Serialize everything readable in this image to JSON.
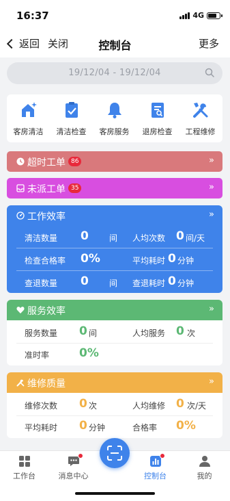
{
  "status_bar": {
    "time": "16:37",
    "network": "4G"
  },
  "nav": {
    "back_label": "返回",
    "close_label": "关闭",
    "title": "控制台",
    "more_label": "更多"
  },
  "date_range": "19/12/04 - 19/12/04",
  "quick_actions": [
    {
      "label": "客房清洁",
      "icon": "house-sparkle-icon"
    },
    {
      "label": "清洁检查",
      "icon": "clipboard-check-icon"
    },
    {
      "label": "客房服务",
      "icon": "bell-icon"
    },
    {
      "label": "退房检查",
      "icon": "document-search-icon"
    },
    {
      "label": "工程维修",
      "icon": "tools-icon"
    }
  ],
  "overdue": {
    "title": "超时工单",
    "count": "86",
    "arrow": "»",
    "color": "#d9797c"
  },
  "unassigned": {
    "title": "未派工单",
    "count": "35",
    "arrow": "»",
    "color": "#d84ee0"
  },
  "work_efficiency": {
    "title": "工作效率",
    "arrow": "»",
    "color": "#3f83ea",
    "rows": [
      {
        "left_label": "清洁数量",
        "left_value": "0",
        "left_unit": "间",
        "right_label": "人均次数",
        "right_value": "0",
        "right_unit": "间/天"
      },
      {
        "left_label": "检查合格率",
        "left_value": "0%",
        "left_unit": "",
        "right_label": "平均耗时",
        "right_value": "0",
        "right_unit": "分钟"
      },
      {
        "left_label": "查退数量",
        "left_value": "0",
        "left_unit": "间",
        "right_label": "查退耗时",
        "right_value": "0",
        "right_unit": "分钟"
      }
    ]
  },
  "service_efficiency": {
    "title": "服务效率",
    "arrow": "»",
    "color": "#5cb874",
    "rows": [
      {
        "left_label": "服务数量",
        "left_value": "0",
        "left_unit": "间",
        "right_label": "人均服务",
        "right_value": "0",
        "right_unit": "次"
      },
      {
        "left_label": "准时率",
        "left_value": "0%",
        "left_unit": "",
        "right_label": "",
        "right_value": "",
        "right_unit": ""
      }
    ]
  },
  "repair_quality": {
    "title": "维修质量",
    "arrow": "»",
    "color": "#f2b148",
    "rows": [
      {
        "left_label": "维修次数",
        "left_value": "0",
        "left_unit": "次",
        "right_label": "人均维修",
        "right_value": "0",
        "right_unit": "次/天"
      },
      {
        "left_label": "平均耗时",
        "left_value": "0",
        "left_unit": "分钟",
        "right_label": "合格率",
        "right_value": "0%",
        "right_unit": ""
      }
    ]
  },
  "tabs": [
    {
      "label": "工作台",
      "icon": "grid-icon",
      "active": false
    },
    {
      "label": "消息中心",
      "icon": "chat-icon",
      "active": false,
      "badge": true
    },
    {
      "label": "控制台",
      "icon": "chart-icon",
      "active": true,
      "badge": true
    },
    {
      "label": "我的",
      "icon": "user-icon",
      "active": false
    }
  ],
  "colors": {
    "accent": "#3f83ea",
    "badge": "#e8293b",
    "text": "#333333"
  }
}
